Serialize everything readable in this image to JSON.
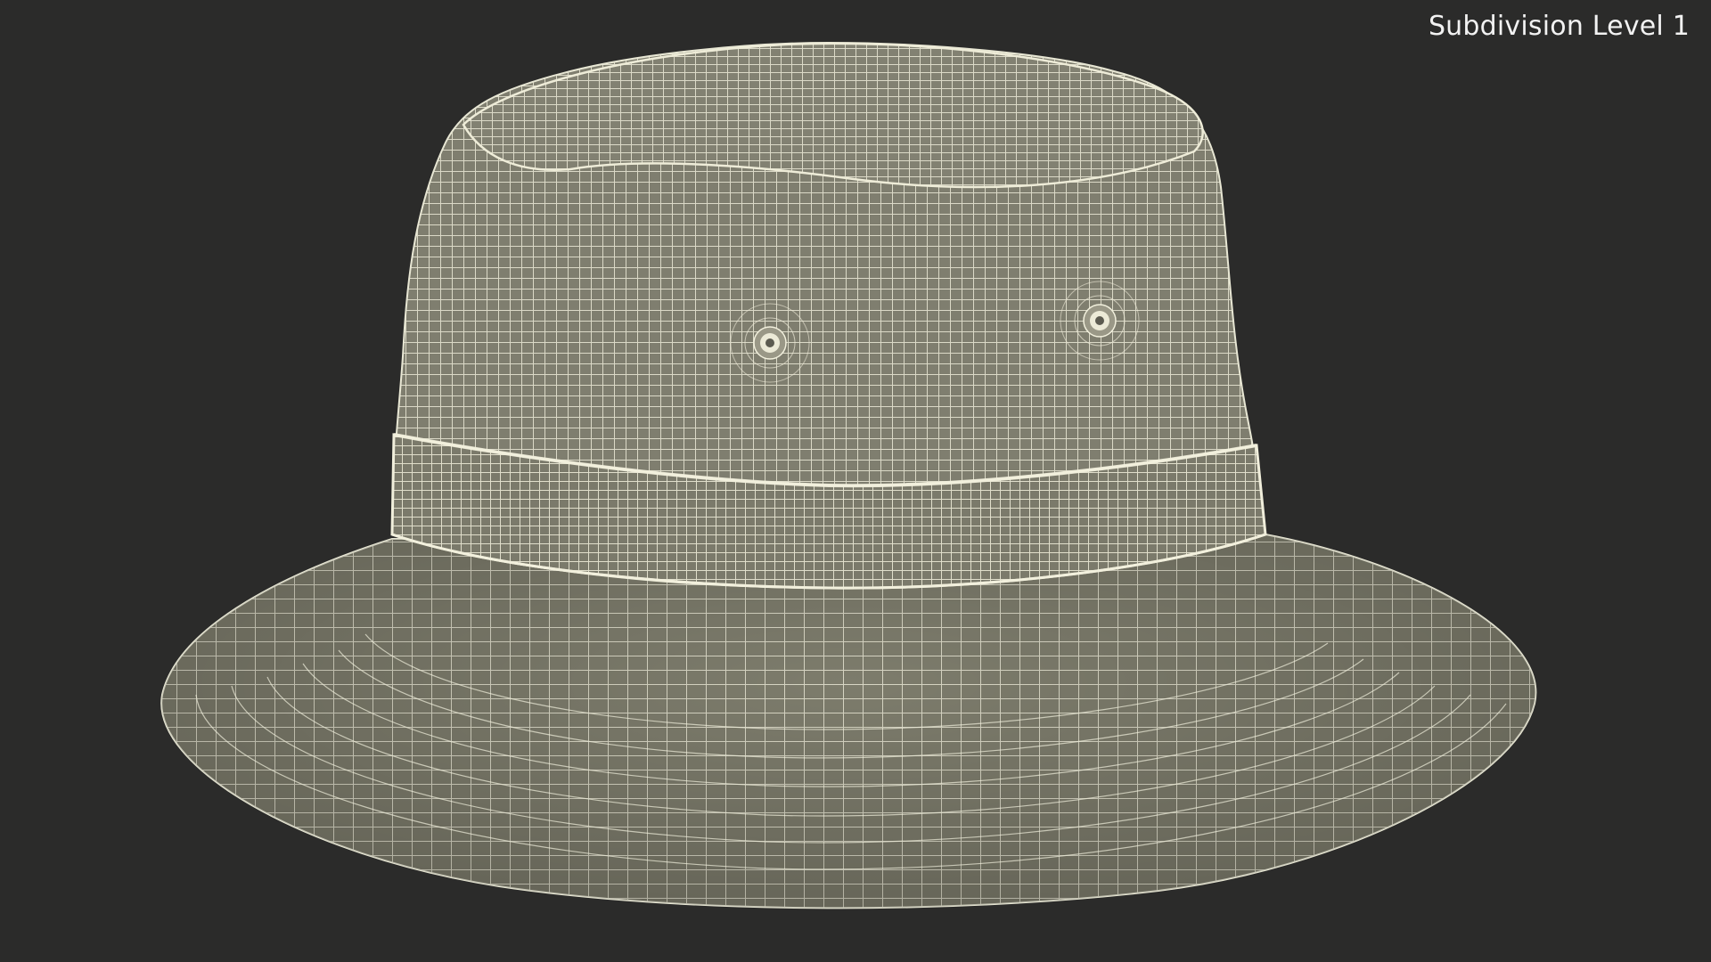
{
  "viewport": {
    "label": "Subdivision Level 1",
    "background_color": "#2b2b2a",
    "mesh_fill_color": "#7c7b6c",
    "wire_color": "#e6e5d2"
  },
  "model": {
    "object": "bucket-hat-wireframe"
  }
}
